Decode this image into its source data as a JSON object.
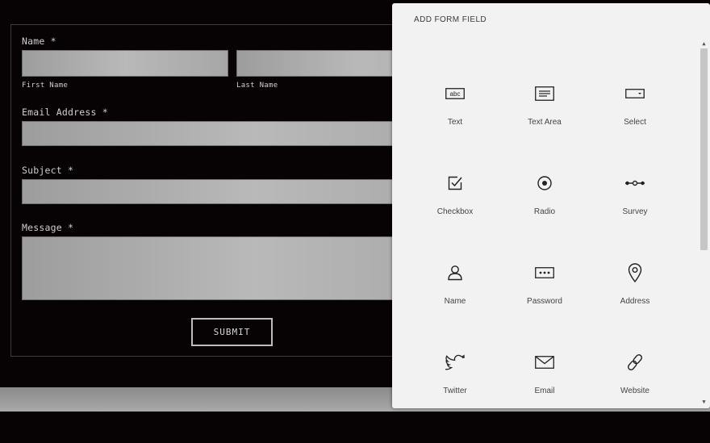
{
  "form": {
    "name_label": "Name *",
    "first_name_sublabel": "First Name",
    "last_name_sublabel": "Last Name",
    "email_label": "Email Address *",
    "subject_label": "Subject *",
    "message_label": "Message *",
    "submit_label": "SUBMIT"
  },
  "panel": {
    "title": "ADD FORM FIELD",
    "fields": [
      {
        "label": "Text",
        "icon": "text-icon"
      },
      {
        "label": "Text Area",
        "icon": "textarea-icon"
      },
      {
        "label": "Select",
        "icon": "select-icon"
      },
      {
        "label": "Checkbox",
        "icon": "checkbox-icon"
      },
      {
        "label": "Radio",
        "icon": "radio-icon"
      },
      {
        "label": "Survey",
        "icon": "survey-icon"
      },
      {
        "label": "Name",
        "icon": "person-icon"
      },
      {
        "label": "Password",
        "icon": "password-icon"
      },
      {
        "label": "Address",
        "icon": "map-pin-icon"
      },
      {
        "label": "Twitter",
        "icon": "twitter-icon"
      },
      {
        "label": "Email",
        "icon": "envelope-icon"
      },
      {
        "label": "Website",
        "icon": "link-icon"
      }
    ],
    "text_icon_glyph": "abc"
  },
  "colors": {
    "page_bg": "#070203",
    "panel_bg": "#f2f2f2",
    "field_fill": "#b0b0b0"
  }
}
